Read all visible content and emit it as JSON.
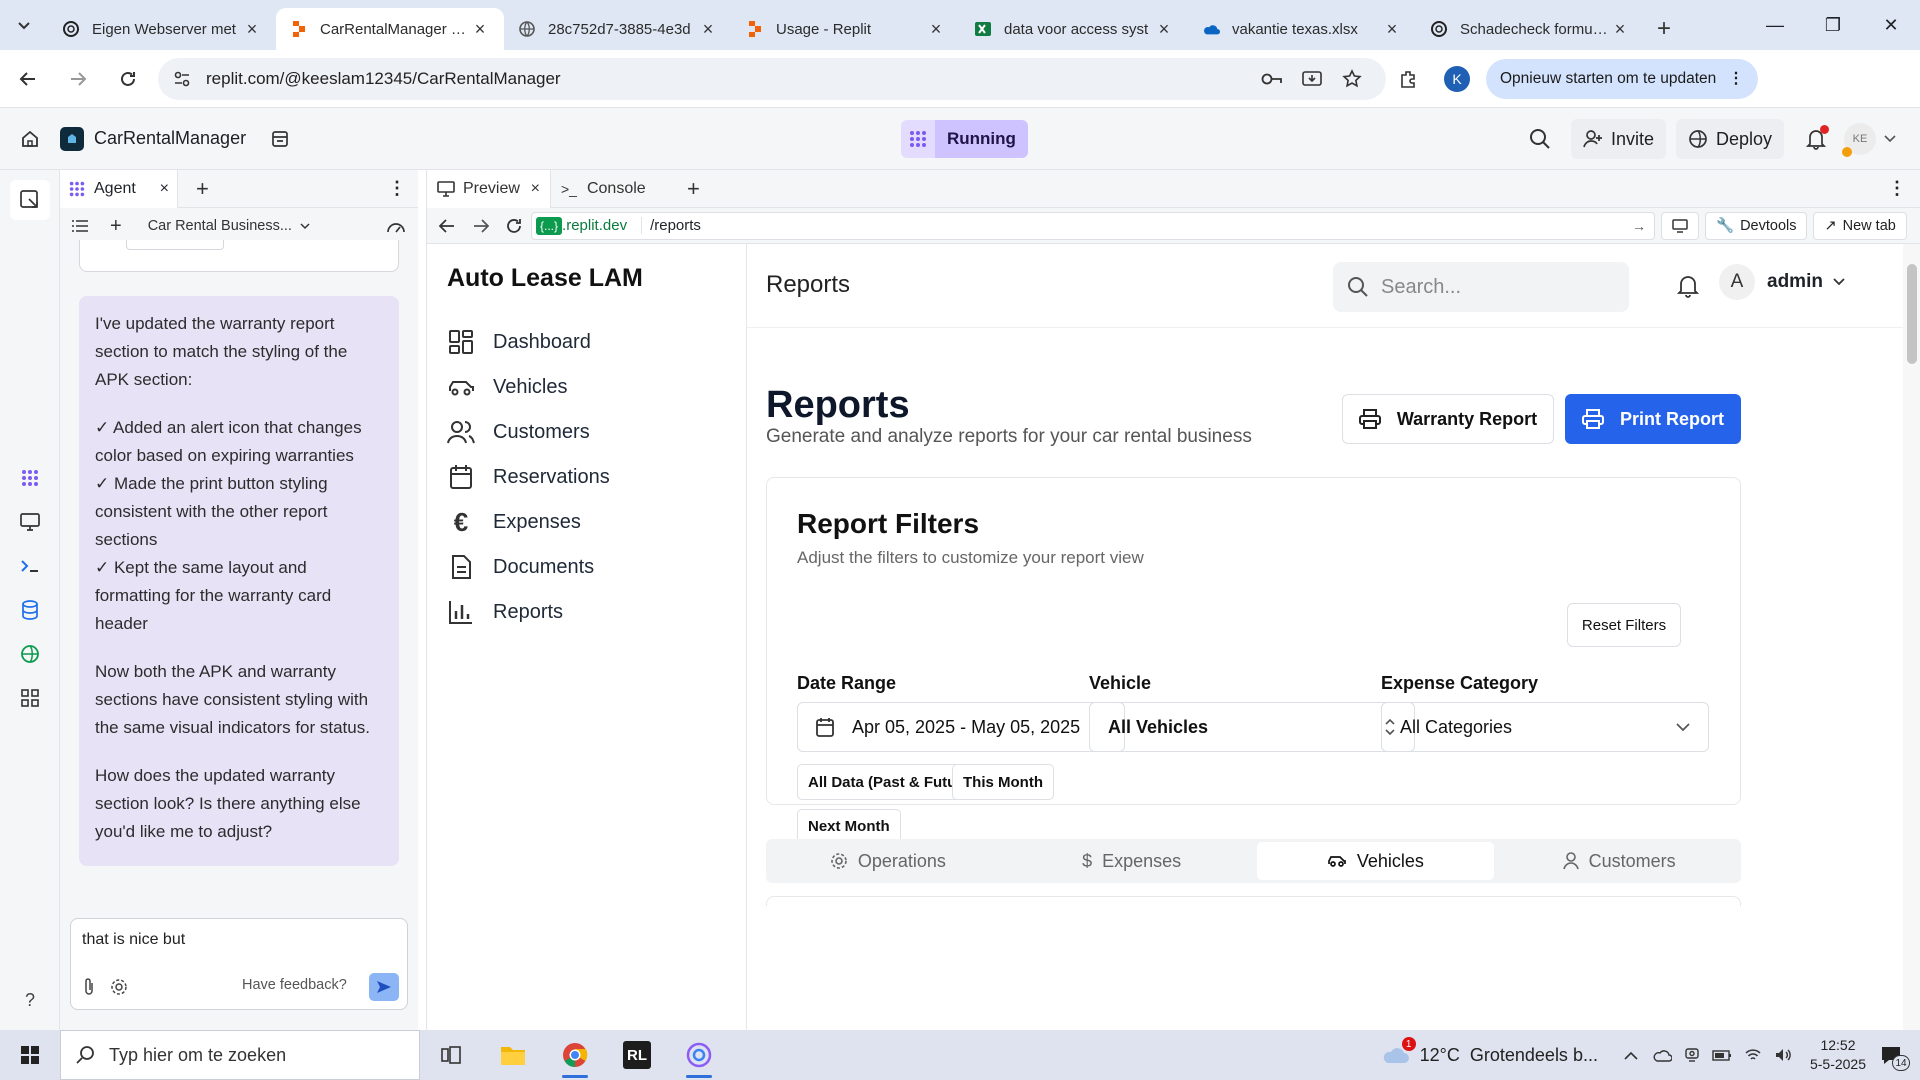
{
  "browser": {
    "tabs": [
      {
        "title": "Eigen Webserver met",
        "icon": "chatgpt-icon"
      },
      {
        "title": "CarRentalManager - Replit",
        "icon": "replit-icon",
        "active": true
      },
      {
        "title": "28c752d7-3885-4e3d",
        "icon": "globe-icon"
      },
      {
        "title": "Usage - Replit",
        "icon": "replit-icon"
      },
      {
        "title": "data voor access syst",
        "icon": "excel-icon"
      },
      {
        "title": "vakantie texas.xlsx",
        "icon": "onedrive-icon"
      },
      {
        "title": "Schadecheck formulier",
        "icon": "chatgpt-icon"
      }
    ],
    "url": "replit.com/@keeslam12345/CarRentalManager",
    "profile_initial": "K",
    "update_button": "Opnieuw starten om te updaten"
  },
  "replit": {
    "project_name": "CarRentalManager",
    "status": "Running",
    "invite": "Invite",
    "deploy": "Deploy",
    "avatar_initials": "KE",
    "agent_tab": "Agent",
    "chat_title": "Car Rental Business...",
    "agent_message": [
      "I've updated the warranty report section to match the styling of the APK section:",
      "✓ Added an alert icon that changes color based on expiring warranties\n✓ Made the print button styling consistent with the other report sections\n✓ Kept the same layout and formatting for the warranty card header",
      "Now both the APK and warranty sections have consistent styling with the same visual indicators for status.",
      "How does the updated warranty section look? Is there anything else you'd like me to adjust?"
    ],
    "composer_text": "that is nice but",
    "feedback": "Have feedback?",
    "preview_tab": "Preview",
    "console_tab": "Console",
    "preview_domain_chip": "{...}",
    "preview_domain": ".replit.dev",
    "preview_path": "/reports",
    "devtools": "Devtools",
    "new_tab": "New tab"
  },
  "app": {
    "brand": "Auto Lease LAM",
    "nav": [
      {
        "label": "Dashboard",
        "icon": "dashboard-icon"
      },
      {
        "label": "Vehicles",
        "icon": "car-icon"
      },
      {
        "label": "Customers",
        "icon": "users-icon"
      },
      {
        "label": "Reservations",
        "icon": "calendar-icon"
      },
      {
        "label": "Expenses",
        "icon": "euro-icon"
      },
      {
        "label": "Documents",
        "icon": "document-icon"
      },
      {
        "label": "Reports",
        "icon": "bar-chart-icon"
      }
    ],
    "header_title": "Reports",
    "search_placeholder": "Search...",
    "user_initial": "A",
    "user_name": "admin",
    "page_title": "Reports",
    "page_subtitle": "Generate and analyze reports for your car rental business",
    "warranty_button": "Warranty Report",
    "print_button": "Print Report",
    "filters": {
      "title": "Report Filters",
      "description": "Adjust the filters to customize your report view",
      "reset": "Reset Filters",
      "date_label": "Date Range",
      "date_value": "Apr 05, 2025 - May 05, 2025",
      "vehicle_label": "Vehicle",
      "vehicle_value": "All Vehicles",
      "category_label": "Expense Category",
      "category_value": "All Categories",
      "quick": [
        "All Data (Past & Future)",
        "This Month",
        "Next Month"
      ]
    },
    "tabs": [
      {
        "label": "Operations",
        "icon": "gear-icon"
      },
      {
        "label": "Expenses",
        "icon": "dollar-icon"
      },
      {
        "label": "Vehicles",
        "icon": "car-icon",
        "active": true
      },
      {
        "label": "Customers",
        "icon": "user-icon"
      }
    ]
  },
  "taskbar": {
    "search_placeholder": "Typ hier om te zoeken",
    "weather": "12°C  Grotendeels b...",
    "weather_badge": "1",
    "time": "12:52",
    "date": "5-5-2025",
    "notifications": "14"
  }
}
